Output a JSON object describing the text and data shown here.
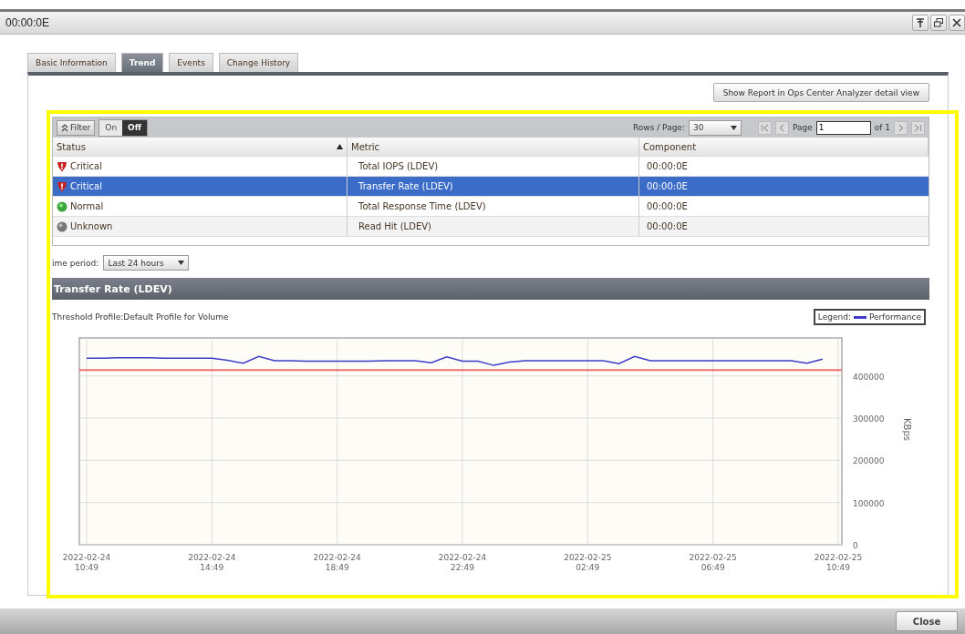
{
  "window": {
    "title": "00:00:0E"
  },
  "tabs": [
    {
      "label": "Basic Information",
      "selected": false
    },
    {
      "label": "Trend",
      "selected": true
    },
    {
      "label": "Events",
      "selected": false
    },
    {
      "label": "Change History",
      "selected": false
    }
  ],
  "report_button": "Show Report in Ops Center Analyzer detail view",
  "filter": {
    "label": "Filter",
    "toggle": [
      {
        "label": "On",
        "selected": false
      },
      {
        "label": "Off",
        "selected": true
      }
    ]
  },
  "pager": {
    "rows_label": "Rows / Page:",
    "rows_value": "30",
    "page_label": "Page",
    "page_value": "1",
    "of_label": "of 1"
  },
  "table": {
    "columns": [
      {
        "label": "Status",
        "sorted": true
      },
      {
        "label": "Metric",
        "sorted": false
      },
      {
        "label": "Component",
        "sorted": false
      }
    ],
    "rows": [
      {
        "kind": "critical",
        "status": "Critical",
        "metric": "Total IOPS (LDEV)",
        "component": "00:00:0E",
        "selected": false
      },
      {
        "kind": "critical",
        "status": "Critical",
        "metric": "Transfer Rate (LDEV)",
        "component": "00:00:0E",
        "selected": true
      },
      {
        "kind": "normal",
        "status": "Normal",
        "metric": "Total Response Time (LDEV)",
        "component": "00:00:0E",
        "selected": false
      },
      {
        "kind": "unknown",
        "status": "Unknown",
        "metric": "Read Hit (LDEV)",
        "component": "00:00:0E",
        "selected": false
      }
    ]
  },
  "time_period": {
    "label": "ime period:",
    "value": "Last 24 hours"
  },
  "section_title": "Transfer Rate (LDEV)",
  "threshold_profile": "Threshold Profile:Default Profile for Volume",
  "legend": {
    "label": "Legend:"
  },
  "chart_data": {
    "type": "line",
    "ylabel": "KBps",
    "categories": [
      "2022-02-24 10:49",
      null,
      null,
      null,
      null,
      null,
      null,
      null,
      "2022-02-24 14:49",
      null,
      null,
      null,
      null,
      null,
      null,
      null,
      "2022-02-24 18:49",
      null,
      null,
      null,
      null,
      null,
      null,
      null,
      "2022-02-24 22:49",
      null,
      null,
      null,
      null,
      null,
      null,
      null,
      "2022-02-25 02:49",
      null,
      null,
      null,
      null,
      null,
      null,
      null,
      "2022-02-25 06:49",
      null,
      null,
      null,
      null,
      null,
      null,
      null,
      "2022-02-25 10:49"
    ],
    "series": [
      {
        "name": "Performance",
        "color": "#3c3cc8",
        "values": [
          442000,
          442000,
          443000,
          443000,
          443000,
          442000,
          442000,
          442000,
          442000,
          437000,
          430000,
          446000,
          436000,
          436000,
          435000,
          435000,
          435000,
          435000,
          435000,
          436000,
          436000,
          436000,
          431000,
          445000,
          435000,
          435000,
          425000,
          433000,
          436000,
          436000,
          436000,
          436000,
          436000,
          436000,
          429000,
          446000,
          436000,
          436000,
          436000,
          436000,
          436000,
          436000,
          436000,
          436000,
          436000,
          436000,
          430000,
          440000,
          null
        ]
      }
    ],
    "ylim": [
      0,
      490000
    ],
    "yticks": [
      0,
      100000,
      200000,
      300000,
      400000
    ],
    "grid": true,
    "ref_lines": [
      {
        "axis": "y",
        "value": 414000,
        "color": "#f07070"
      }
    ]
  },
  "close_button": "Close"
}
